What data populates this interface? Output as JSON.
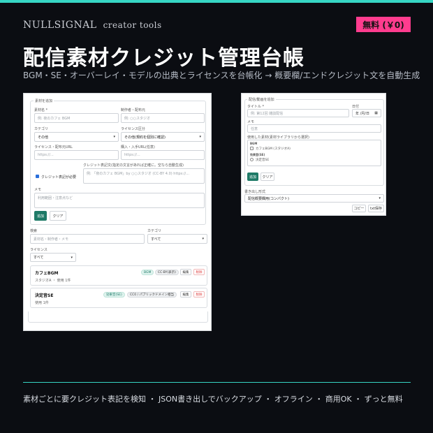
{
  "brand": {
    "name": "NULLSIGNAL",
    "sub": "creator tools"
  },
  "price_badge": "無料 (￥0)",
  "headline": "配信素材クレジット管理台帳",
  "subline": "BGM・SE・オーバーレイ・モデルの出典とライセンスを台帳化 → 概要欄/エンドクレジット文を自動生成",
  "left": {
    "legend": "素材を追加",
    "name_label": "素材名 *",
    "name_placeholder": "例: 夜のカフェ BGM",
    "author_label": "制作者・配布元",
    "author_placeholder": "例: ○○スタジオ",
    "category_label": "カテゴリ",
    "category_value": "その他",
    "license_label": "ライセンス区分",
    "license_value": "その他(規約を個別に確認)",
    "license_url_label": "ライセンス・配布元URL",
    "license_url_placeholder": "https://...",
    "purchase_url_label": "購入・入手URL(任意)",
    "purchase_url_placeholder": "https://...",
    "credit_label": "クレジット表記文(指定の文言があれば正確に。空なら自動生成)",
    "credit_check_label": "クレジット表記が必要",
    "credit_placeholder": "例: 「夜のカフェ BGM」by ○○スタジオ (CC-BY 4.0) https://...",
    "memo_label": "メモ",
    "memo_placeholder": "利用範囲・注意点など",
    "add_button": "追加",
    "clear_button": "クリア",
    "search_label": "検索",
    "search_placeholder": "素材名・制作者・メモ",
    "filter_category_label": "カテゴリ",
    "filter_category_value": "すべて",
    "filter_license_label": "ライセンス",
    "filter_license_value": "すべて",
    "items": [
      {
        "title": "カフェBGM",
        "meta": "スタジオA ・ 使用 1件",
        "tags": [
          "BGM",
          "CC-BY(表示)"
        ],
        "edit": "編集",
        "delete": "削除"
      },
      {
        "title": "決定音SE",
        "meta": "使用 1件",
        "tags": [
          "効果音(SE)",
          "CC0 / パブリックドメイン相当"
        ],
        "edit": "編集",
        "delete": "削除"
      }
    ]
  },
  "right": {
    "legend": "配信/動画を追加",
    "title_label": "タイトル *",
    "title_placeholder": "例: 第12回 雑談配信",
    "date_label": "日付",
    "date_placeholder": "年 /月/日",
    "memo_label": "メモ",
    "memo_placeholder": "任意",
    "used_label": "使用した素材(素材ライブラリから選択)",
    "group1": "BGM",
    "item1": "カフェBGM (スタジオA)",
    "group2": "効果音(SE)",
    "item2": "決定音SE",
    "add_button": "追加",
    "clear_button": "クリア",
    "export_label": "書き出し形式",
    "export_value": "配信概要欄用(コンパクト)",
    "copy_button": "コピー",
    "save_button": "txt保存"
  },
  "footer": "素材ごとに要クレジット表記を検知 ・ JSON書き出しでバックアップ ・ オフライン ・ 商用OK ・ ずっと無料"
}
